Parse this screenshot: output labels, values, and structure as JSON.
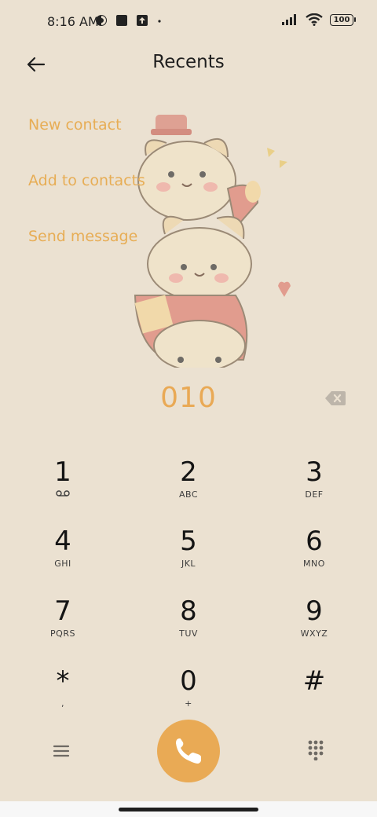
{
  "status_bar": {
    "time": "8:16 AM",
    "battery": "100",
    "icons": [
      "vpn-icon",
      "square-icon",
      "upload-icon",
      "dot-icon",
      "signal-icon",
      "wifi-icon",
      "battery-icon"
    ]
  },
  "header": {
    "title": "Recents",
    "back_icon": "arrow-left-icon"
  },
  "menu": {
    "new_contact": "New contact",
    "add_to_contacts": "Add to contacts",
    "send_message": "Send message"
  },
  "dialer": {
    "number": "010",
    "backspace_icon": "backspace-icon"
  },
  "keypad": [
    {
      "digit": "1",
      "letters": ""
    },
    {
      "digit": "2",
      "letters": "ABC"
    },
    {
      "digit": "3",
      "letters": "DEF"
    },
    {
      "digit": "4",
      "letters": "GHI"
    },
    {
      "digit": "5",
      "letters": "JKL"
    },
    {
      "digit": "6",
      "letters": "MNO"
    },
    {
      "digit": "7",
      "letters": "PQRS"
    },
    {
      "digit": "8",
      "letters": "TUV"
    },
    {
      "digit": "9",
      "letters": "WXYZ"
    },
    {
      "digit": "*",
      "letters": ","
    },
    {
      "digit": "0",
      "letters": "+"
    },
    {
      "digit": "#",
      "letters": ""
    }
  ],
  "actions": {
    "menu_icon": "hamburger-icon",
    "call_icon": "phone-icon",
    "dialpad_icon": "dialpad-icon"
  },
  "colors": {
    "background": "#ebe1d1",
    "accent": "#e9aa55",
    "text": "#1c1c1c"
  }
}
